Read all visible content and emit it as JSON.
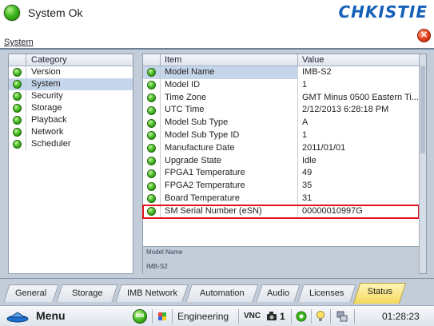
{
  "window": {
    "title": "System Ok",
    "brand": "CHKISTIE",
    "close_symbol": "✕"
  },
  "section": {
    "label": "System"
  },
  "categories": {
    "header": "Category",
    "items": [
      {
        "label": "Version",
        "selected": false
      },
      {
        "label": "System",
        "selected": true
      },
      {
        "label": "Security",
        "selected": false
      },
      {
        "label": "Storage",
        "selected": false
      },
      {
        "label": "Playback",
        "selected": false
      },
      {
        "label": "Network",
        "selected": false
      },
      {
        "label": "Scheduler",
        "selected": false
      }
    ]
  },
  "grid": {
    "columns": {
      "item": "Item",
      "value": "Value"
    },
    "rows": [
      {
        "item": "Model Name",
        "value": "IMB-S2"
      },
      {
        "item": "Model ID",
        "value": "1"
      },
      {
        "item": "Time Zone",
        "value": "GMT Minus 0500 Eastern Ti..."
      },
      {
        "item": "UTC Time",
        "value": "2/12/2013 6:28:18 PM"
      },
      {
        "item": "Model Sub Type",
        "value": "A"
      },
      {
        "item": "Model Sub Type ID",
        "value": "1"
      },
      {
        "item": "Manufacture Date",
        "value": "2011/01/01"
      },
      {
        "item": "Upgrade State",
        "value": "Idle"
      },
      {
        "item": "FPGA1 Temperature",
        "value": "49"
      },
      {
        "item": "FPGA2 Temperature",
        "value": "35"
      },
      {
        "item": "Board Temperature",
        "value": "31"
      },
      {
        "item": "SM Serial Number (eSN)",
        "value": "00000010997G"
      }
    ],
    "description": {
      "title": "Model Name",
      "value": "IMB-S2"
    }
  },
  "tabs": [
    {
      "label": "General",
      "active": false
    },
    {
      "label": "Storage",
      "active": false
    },
    {
      "label": "IMB Network",
      "active": false
    },
    {
      "label": "Automation",
      "active": false
    },
    {
      "label": "Audio",
      "active": false
    },
    {
      "label": "Licenses",
      "active": false
    },
    {
      "label": "Status",
      "active": true
    }
  ],
  "statusbar": {
    "menu_label": "Menu",
    "imb_badge": "IMB",
    "user": "Engineering",
    "vnc": "VNC",
    "count": "1",
    "clock": "01:28:23 PM"
  },
  "colors": {
    "brand": "#1560b8",
    "panel": "#c3cdd9",
    "highlight_box": "#e0121b",
    "active_tab": "#f4d95a",
    "status_ok": "#3fb81e"
  },
  "icons": [
    "status-ok-icon",
    "close-icon",
    "menu-icon",
    "imb-status-icon",
    "flag-icon",
    "camera-icon",
    "power-icon",
    "bulb-icon",
    "network-icon"
  ]
}
